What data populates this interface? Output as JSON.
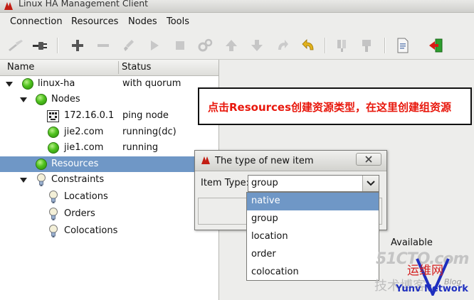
{
  "window": {
    "title": "Linux HA Management Client"
  },
  "menu": {
    "items": [
      "Connection",
      "Resources",
      "Nodes",
      "Tools"
    ]
  },
  "tree": {
    "headers": {
      "name": "Name",
      "status": "Status"
    },
    "rows": [
      {
        "label": "linux-ha",
        "status": "with quorum",
        "icon": "green-status-dot"
      },
      {
        "label": "Nodes",
        "status": "",
        "icon": "green-status-dot"
      },
      {
        "label": "172.16.0.1",
        "status": "ping node",
        "icon": "ping-node-icon"
      },
      {
        "label": "jie2.com",
        "status": "running(dc)",
        "icon": "green-status-dot"
      },
      {
        "label": "jie1.com",
        "status": "running",
        "icon": "green-status-dot"
      },
      {
        "label": "Resources",
        "status": "",
        "icon": "green-status-dot"
      },
      {
        "label": "Constraints",
        "status": "",
        "icon": "lightbulb-icon"
      },
      {
        "label": "Locations",
        "status": "",
        "icon": "lightbulb-icon"
      },
      {
        "label": "Orders",
        "status": "",
        "icon": "lightbulb-icon"
      },
      {
        "label": "Colocations",
        "status": "",
        "icon": "lightbulb-icon"
      }
    ]
  },
  "annotation": {
    "text": "点击Resources创建资源类型，在这里创建组资源"
  },
  "right_panel": {
    "available": "Available"
  },
  "dialog": {
    "title": "The type of new item",
    "item_type_label": "Item Type:",
    "selected": "group",
    "options": [
      "native",
      "group",
      "location",
      "order",
      "colocation"
    ],
    "highlighted": "native"
  },
  "watermark": {
    "line1": "51CTO.com",
    "line2": "技术博客",
    "line3": "运维网",
    "blog": "Blog",
    "line4": "Yunv Network"
  },
  "colors": {
    "selection": "#6f97c6",
    "annotation": "#e8170c",
    "status_green": "#4fc21e"
  }
}
